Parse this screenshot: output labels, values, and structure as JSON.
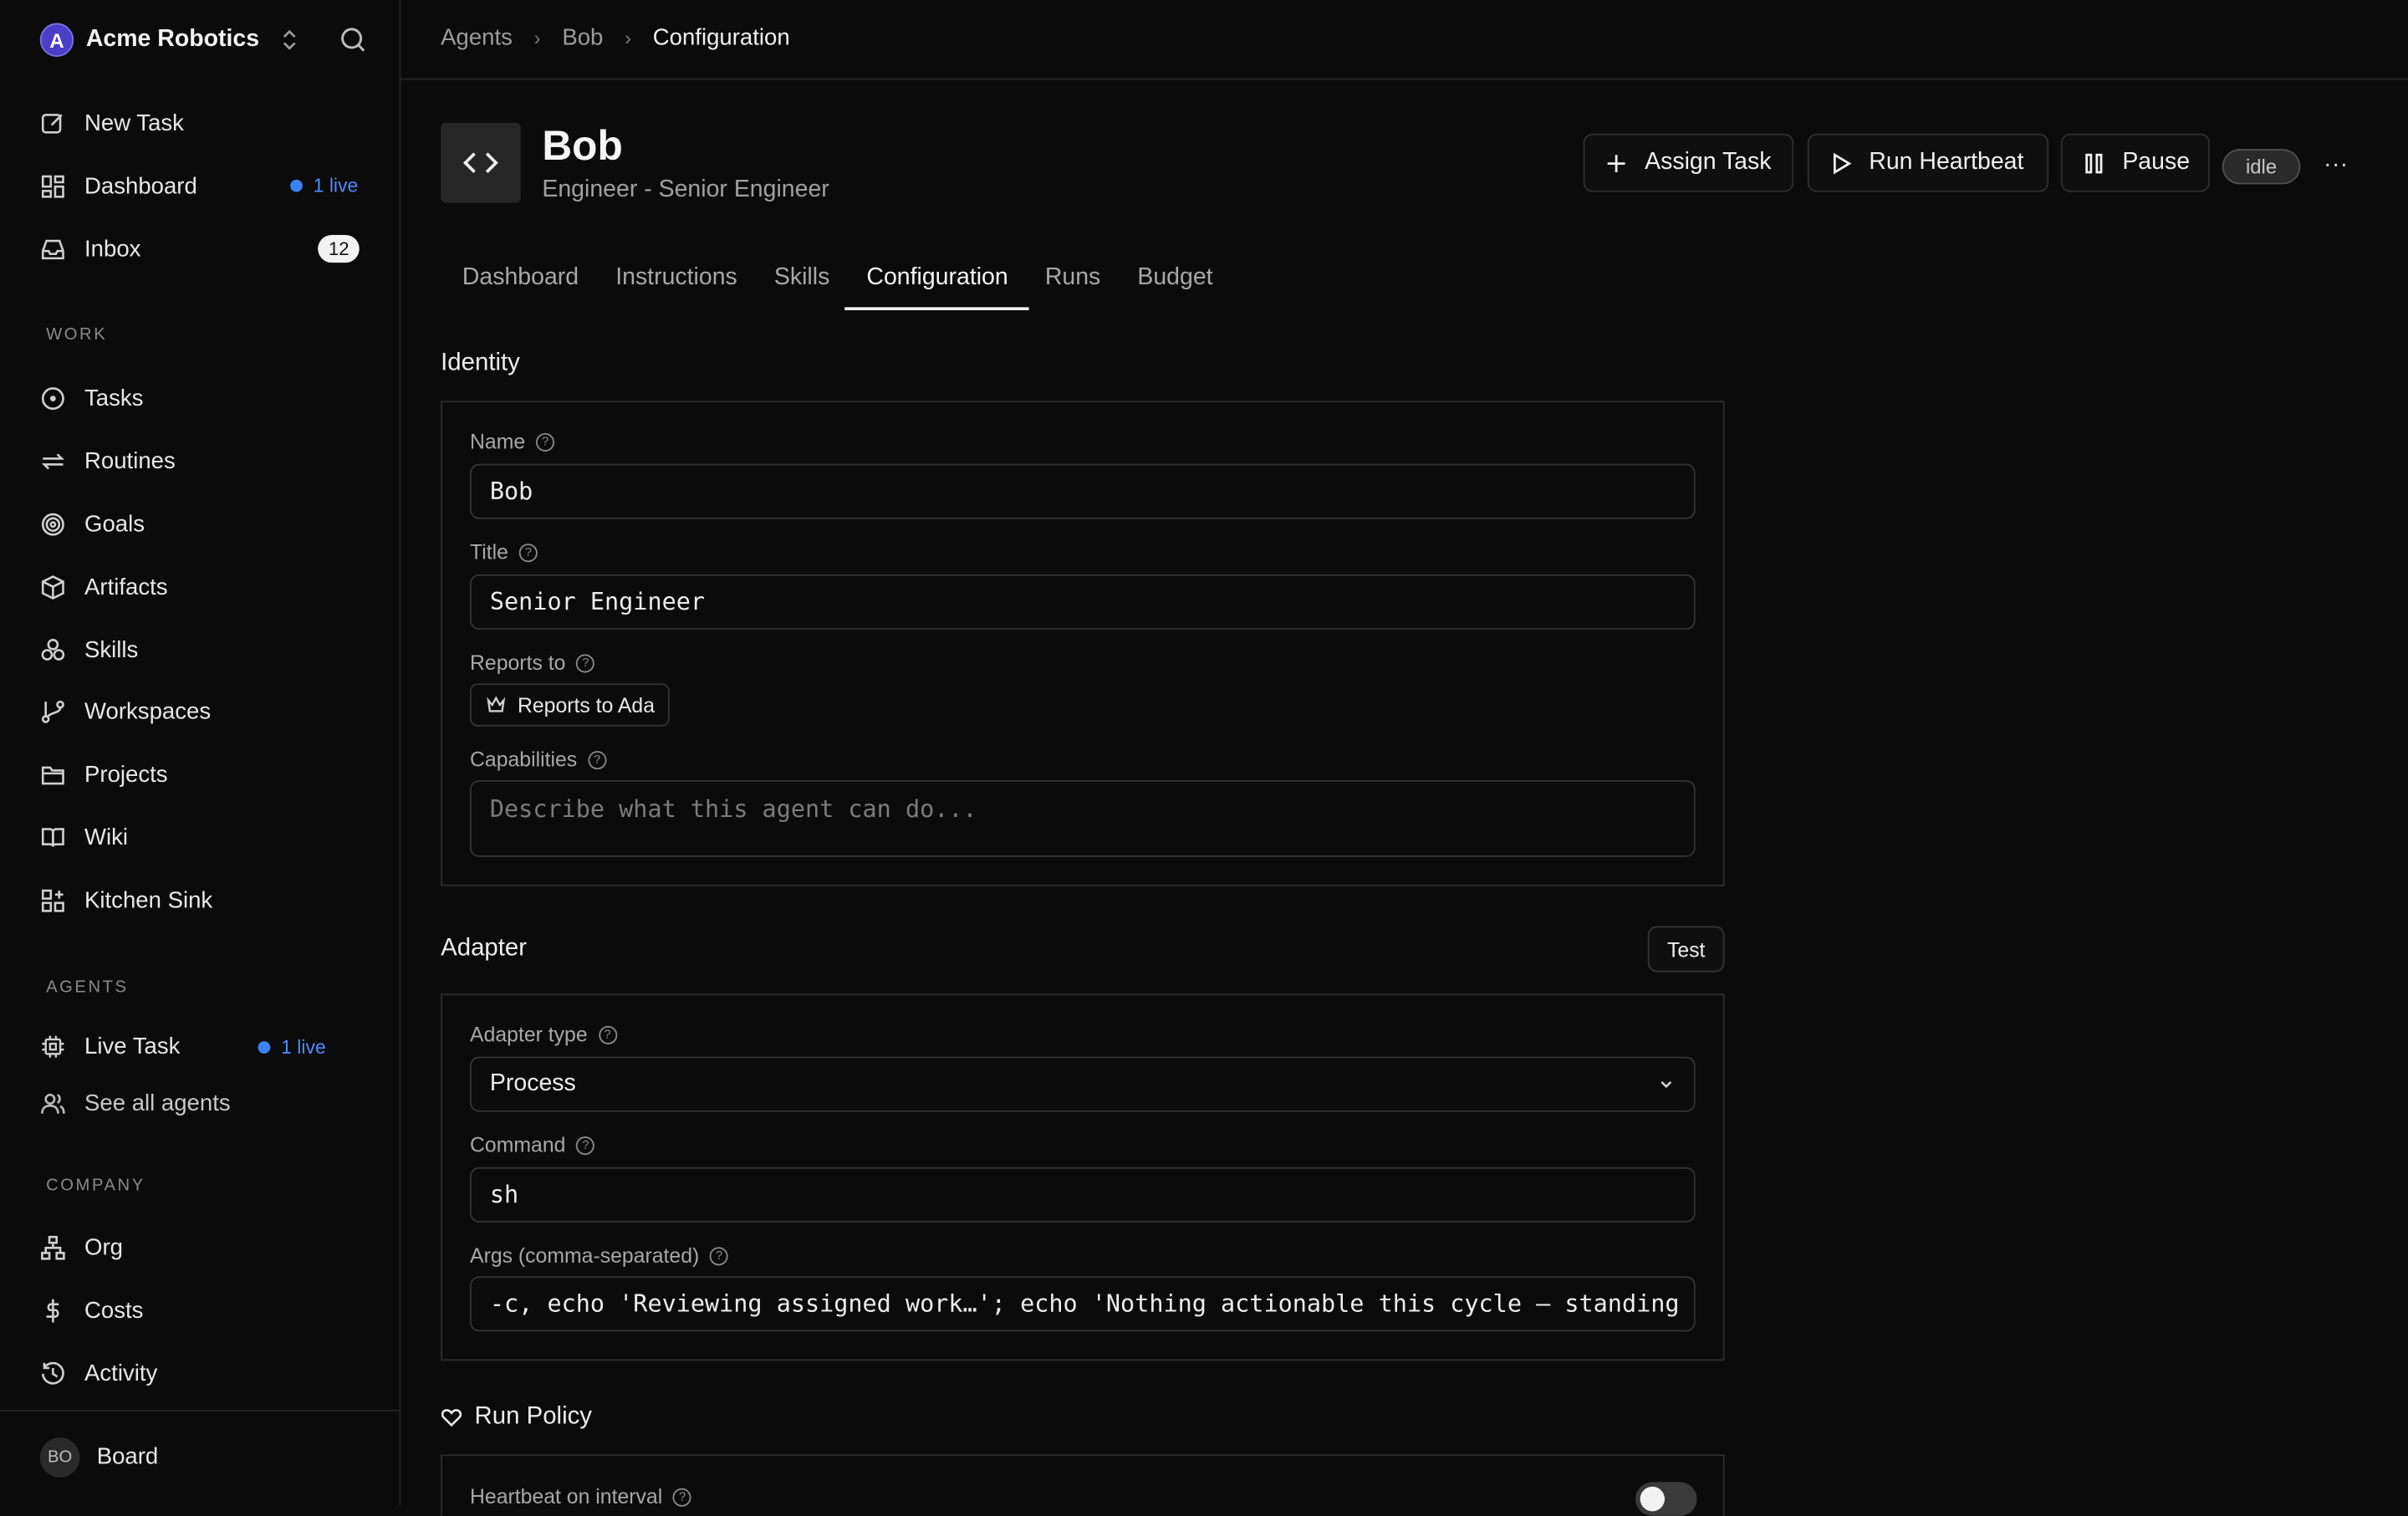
{
  "workspace": {
    "logo_letter": "A",
    "name": "Acme Robotics"
  },
  "nav": {
    "new_task": "New Task",
    "dashboard": "Dashboard",
    "dashboard_live": "1 live",
    "inbox": "Inbox",
    "inbox_count": "12"
  },
  "sections": {
    "work": "WORK",
    "agents": "AGENTS",
    "company": "COMPANY"
  },
  "work_items": [
    "Tasks",
    "Routines",
    "Goals",
    "Artifacts",
    "Skills",
    "Workspaces",
    "Projects",
    "Wiki",
    "Kitchen Sink"
  ],
  "agents": {
    "live_task": "Live Task",
    "live_task_live": "1 live",
    "see_all": "See all agents"
  },
  "company_items": [
    "Org",
    "Costs",
    "Activity"
  ],
  "user": {
    "initials": "BO",
    "name": "Board"
  },
  "breadcrumb": [
    "Agents",
    "Bob",
    "Configuration"
  ],
  "agent": {
    "name": "Bob",
    "subtitle": "Engineer - Senior Engineer",
    "status": "idle"
  },
  "actions": {
    "assign": "Assign Task",
    "heartbeat": "Run Heartbeat",
    "pause": "Pause",
    "more": "···"
  },
  "tabs": [
    "Dashboard",
    "Instructions",
    "Skills",
    "Configuration",
    "Runs",
    "Budget"
  ],
  "active_tab": "Configuration",
  "identity": {
    "title": "Identity",
    "name_label": "Name",
    "name_value": "Bob",
    "title_label": "Title",
    "title_value": "Senior Engineer",
    "reports_label": "Reports to",
    "reports_value": "Reports to Ada",
    "capabilities_label": "Capabilities",
    "capabilities_placeholder": "Describe what this agent can do..."
  },
  "adapter": {
    "title": "Adapter",
    "test_label": "Test",
    "type_label": "Adapter type",
    "type_value": "Process",
    "command_label": "Command",
    "command_value": "sh",
    "args_label": "Args (comma-separated)",
    "args_value": "-c, echo 'Reviewing assigned work…'; echo 'Nothing actionable this cycle — standing by'"
  },
  "run_policy": {
    "title": "Run Policy",
    "heartbeat_label": "Heartbeat on interval",
    "heartbeat_on": false
  }
}
